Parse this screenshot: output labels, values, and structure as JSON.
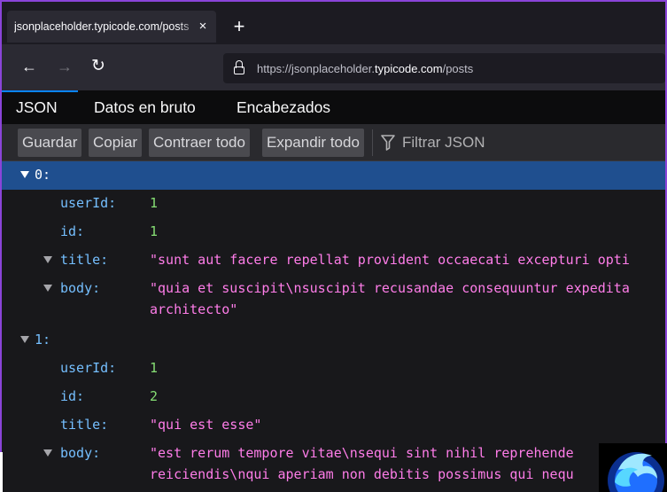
{
  "browser": {
    "tab": {
      "title": "jsonplaceholder.typicode.com/posts",
      "close_glyph": "×"
    },
    "new_tab_glyph": "+",
    "nav": {
      "back_glyph": "←",
      "forward_glyph": "→",
      "reload_glyph": "↻"
    },
    "url": {
      "scheme": "https://",
      "host_prefix": "jsonplaceholder.",
      "host_main": "typicode.com",
      "path": "/posts"
    }
  },
  "viewer": {
    "tabs": [
      {
        "label": "JSON",
        "active": true
      },
      {
        "label": "Datos en bruto",
        "active": false
      },
      {
        "label": "Encabezados",
        "active": false
      }
    ],
    "toolbar": {
      "save": "Guardar",
      "copy": "Copiar",
      "collapse_all": "Contraer todo",
      "expand_all": "Expandir todo",
      "filter_placeholder": "Filtrar JSON"
    }
  },
  "tree": {
    "item0": {
      "index": "0:",
      "userId_key": "userId:",
      "userId": "1",
      "id_key": "id:",
      "id": "1",
      "title_key": "title:",
      "title": "\"sunt aut facere repellat provident occaecati excepturi opti",
      "body_key": "body:",
      "body_line1": "\"quia et suscipit\\nsuscipit recusandae consequuntur expedita",
      "body_line2": "architecto\""
    },
    "item1": {
      "index": "1:",
      "userId_key": "userId:",
      "userId": "1",
      "id_key": "id:",
      "id": "2",
      "title_key": "title:",
      "title": "\"qui est esse\"",
      "body_key": "body:",
      "body_line1": "\"est rerum tempore vitae\\nsequi sint nihil reprehende",
      "body_line2": "reiciendis\\nqui aperiam non debitis possimus qui nequ"
    }
  },
  "colors": {
    "accent": "#8a44d8",
    "selected_row": "#1f4f8f",
    "key": "#75bfff",
    "number": "#86de74",
    "string": "#ff7de9",
    "active_tab_indicator": "#0a84ff"
  },
  "icons": {
    "lock": "lock-icon",
    "filter": "filter-icon",
    "logo": "firefox-logo-icon"
  }
}
